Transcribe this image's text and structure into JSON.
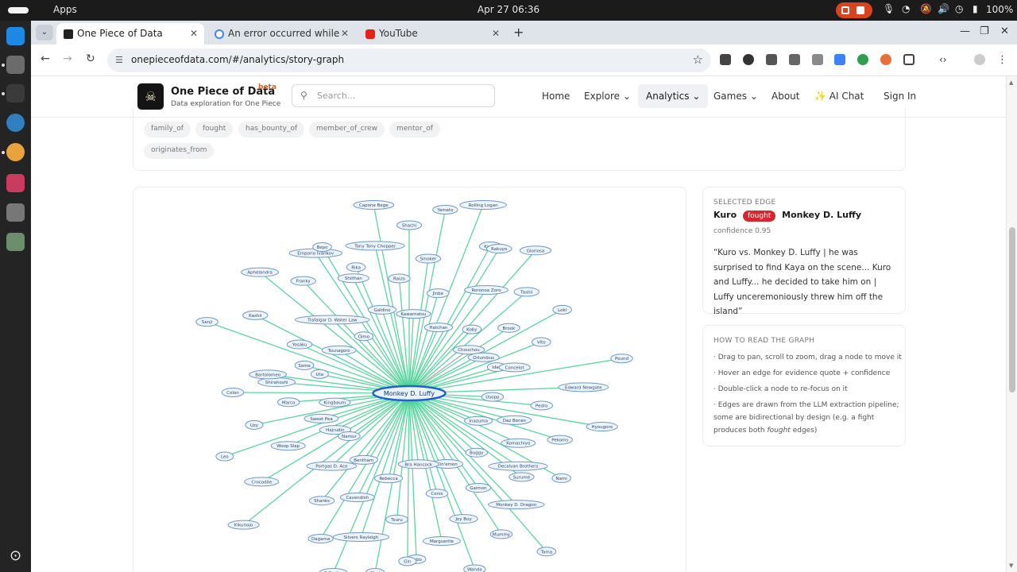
{
  "os": {
    "apps_label": "Apps",
    "clock": "Apr 27  06:36",
    "battery": "100%"
  },
  "browser": {
    "tabs": [
      {
        "title": "One Piece of Data",
        "active": true
      },
      {
        "title": "An error occurred while ",
        "active": false
      },
      {
        "title": "YouTube",
        "active": false
      }
    ],
    "url": "onepieceofdata.com/#/analytics/story-graph"
  },
  "site": {
    "brand": "One Piece of Data",
    "beta": "beta",
    "tagline": "Data exploration for One Piece",
    "search_placeholder": "Search...",
    "nav": {
      "home": "Home",
      "explore": "Explore",
      "analytics": "Analytics",
      "games": "Games",
      "about": "About",
      "ai_chat": "✨ AI Chat",
      "sign_in": "Sign In"
    }
  },
  "filters": {
    "chips": [
      "family_of",
      "fought",
      "has_bounty_of",
      "member_of_crew",
      "mentor_of",
      "originates_from"
    ]
  },
  "selected_edge": {
    "section_title": "SELECTED EDGE",
    "source": "Kuro",
    "relation": "fought",
    "target": "Monkey D. Luffy",
    "confidence": "confidence 0.95",
    "quote": "“Kuro vs. Monkey D. Luffy | he was surprised to find Kaya on the scene... Kuro and Luffy... he decided to take him on | Luffy unceremoniously threw him off the island”"
  },
  "how_to": {
    "section_title": "HOW TO READ THE GRAPH",
    "items": [
      "· Drag to pan, scroll to zoom, drag a node to move it",
      "· Hover an edge for evidence quote + confidence",
      "· Double-click a node to re-focus on it"
    ],
    "last_prefix": "· Edges are drawn from the LLM extraction pipeline; some are bidirectional by design (e.g. a fight produces both ",
    "last_emph": "fought",
    "last_suffix": " edges)"
  },
  "graph": {
    "center": "Monkey D. Luffy",
    "nodes": [
      "Shachi",
      "Monkey D. Dragon",
      "Shirahoshi",
      "Chouchou",
      "Choi",
      "Emporio Ivankov",
      "Daz Bones",
      "Hajrudin",
      "Rolling Logan",
      "Joy Boy",
      "Yosaku",
      "Ideo",
      "Dagama",
      "Tony Tony Chopper",
      "Decalvan Brothers",
      "Kingbaum",
      "Gloriosa",
      "Sabo",
      "Trafalgar D. Water Law",
      "Usopp",
      "Kikunojo",
      "Smoker",
      "Gaimon",
      "Uta",
      "Loki",
      "Silvers Rayleigh",
      "Shiilhan",
      "Inazuma",
      "Leo",
      "Karoo",
      "Conis",
      "Tsunagoro",
      "Pound",
      "Shanks",
      "Raizo",
      "Buggy",
      "Colon",
      "Tashii",
      "Tsuru",
      "Oimo",
      "Hyougoro",
      "Crocodile",
      "Jinbe",
      "Kin'emon",
      "Sanji",
      "Vito",
      "Cavendish",
      "Galdino",
      "Nami",
      "Uzy",
      "Roronoa Zoro",
      "Bra Hancock",
      "Aphelandra",
      "Edward Newgate",
      "Portgas D. Ace",
      "Kawamatsu",
      "Tama",
      "Bartolomeo",
      "Brook",
      "Rebecca",
      "Bepo",
      "Pekoms",
      "Woop Slap",
      "Hatchan",
      "Wanda",
      "Kashii",
      "Concelot",
      "Bentham",
      "Capone Bege",
      "Surume",
      "Marco",
      "Koby",
      "Gin",
      "Franky",
      "Pedro",
      "Namur",
      "Yamato",
      "Mummy",
      "Some",
      "Orlumbus",
      "S-Snake",
      "Rika",
      "Komachiyo",
      "Sweet Pea",
      "Rakuyo",
      "Marguerite"
    ]
  }
}
